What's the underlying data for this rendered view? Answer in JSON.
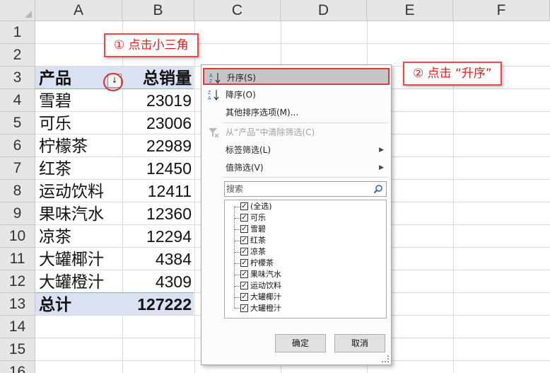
{
  "columns": [
    "A",
    "B",
    "C",
    "D",
    "E",
    "F"
  ],
  "rows": [
    "1",
    "2",
    "3",
    "4",
    "5",
    "6",
    "7",
    "8",
    "9",
    "10",
    "11",
    "12",
    "13",
    "14",
    "15",
    "16"
  ],
  "pivot": {
    "header": {
      "label": "产品",
      "value": "总销量"
    },
    "items": [
      {
        "label": "雪碧",
        "value": "23019"
      },
      {
        "label": "可乐",
        "value": "23006"
      },
      {
        "label": "柠檬茶",
        "value": "22989"
      },
      {
        "label": "红茶",
        "value": "12450"
      },
      {
        "label": "运动饮料",
        "value": "12411"
      },
      {
        "label": "果味汽水",
        "value": "12360"
      },
      {
        "label": "凉茶",
        "value": "12294"
      },
      {
        "label": "大罐椰汁",
        "value": "4384"
      },
      {
        "label": "大罐橙汁",
        "value": "4309"
      }
    ],
    "total": {
      "label": "总计",
      "value": "127222"
    }
  },
  "callouts": {
    "step1": "① 点击小三角",
    "step2": "② 点击 “升序”"
  },
  "filter_button_glyph": "↓",
  "menu": {
    "sort_asc": "升序(S)",
    "sort_desc": "降序(O)",
    "more_sort": "其他排序选项(M)...",
    "clear_filter": "从“产品”中清除筛选(C)",
    "label_filter": "标签筛选(L)",
    "value_filter": "值筛选(V)",
    "search_placeholder": "搜索",
    "tree_items": [
      "(全选)",
      "可乐",
      "雪碧",
      "红茶",
      "凉茶",
      "柠檬茶",
      "果味汽水",
      "运动饮料",
      "大罐椰汁",
      "大罐橙汁"
    ],
    "ok": "确定",
    "cancel": "取消"
  },
  "colors": {
    "accent_red": "#e52d2d",
    "pivot_band": "#d9e1f2",
    "sort_icon_blue": "#2f5fb3"
  }
}
